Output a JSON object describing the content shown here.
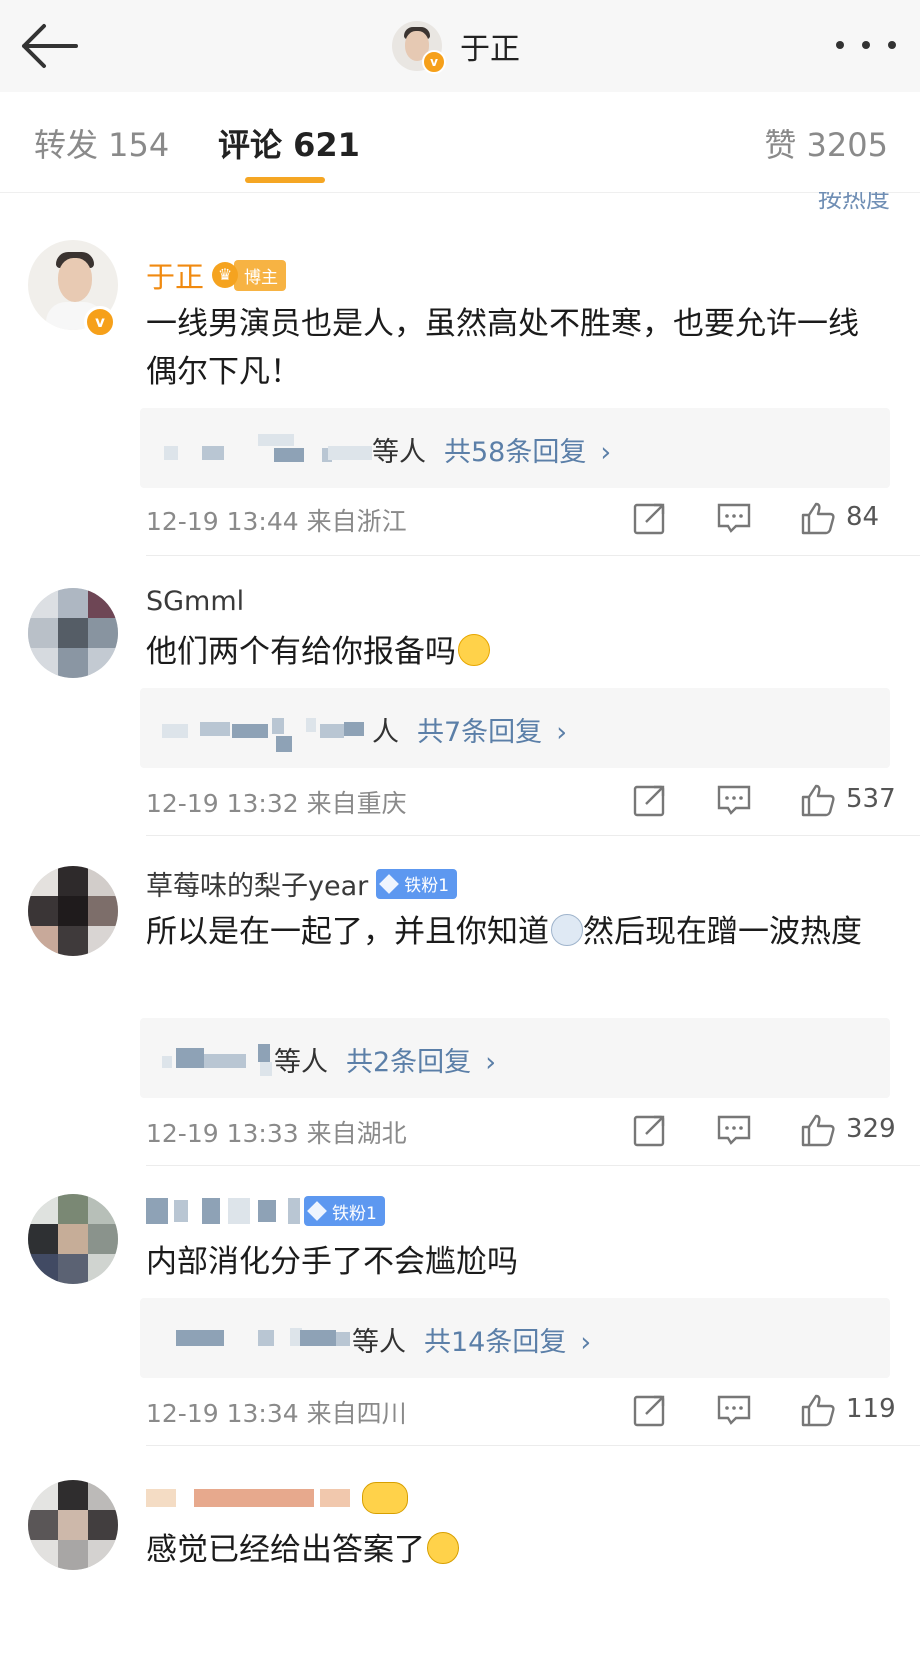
{
  "header": {
    "title": "于正",
    "verified_mark": "v"
  },
  "tabs": {
    "repost": "转发 154",
    "comments": "评论 621",
    "likes": "赞 3205",
    "sort": "按热度"
  },
  "comments": [
    {
      "author": "于正",
      "badge": "博主",
      "text": "一线男演员也是人，虽然高处不胜寒，也要允许一线偶尔下凡！",
      "reply_who": "等人",
      "reply_count": "共58条回复",
      "reply_chevron": "›",
      "time": "12-19 13:44",
      "location": "来自浙江",
      "likes": "84"
    },
    {
      "author": "SGmml",
      "text": "他们两个有给你报备吗",
      "reply_who": "人",
      "reply_count": "共7条回复",
      "reply_chevron": "›",
      "time": "12-19 13:32",
      "location": "来自重庆",
      "likes": "537"
    },
    {
      "author": "草莓味的梨子year",
      "badge": "铁粉1",
      "text_a": "所以是在一起了，并且你知道",
      "text_b": "然后现在蹭一波热度",
      "reply_who": "等人",
      "reply_count": "共2条回复",
      "reply_chevron": "›",
      "time": "12-19 13:33",
      "location": "来自湖北",
      "likes": "329"
    },
    {
      "badge": "铁粉1",
      "text": "内部消化分手了不会尴尬吗",
      "reply_who": "等人",
      "reply_count": "共14条回复",
      "reply_chevron": "›",
      "time": "12-19 13:34",
      "location": "来自四川",
      "likes": "119"
    },
    {
      "text": "感觉已经给出答案了"
    }
  ],
  "icons": {
    "back": "arrow-left-icon",
    "more": "more-dots-icon",
    "share": "share-icon",
    "comment": "comment-icon",
    "like": "thumbs-up-icon"
  },
  "colors": {
    "accent": "#f5a623",
    "author_name": "#f08a10",
    "link": "#5b7fa8",
    "fan_badge": "#5d98f0"
  }
}
